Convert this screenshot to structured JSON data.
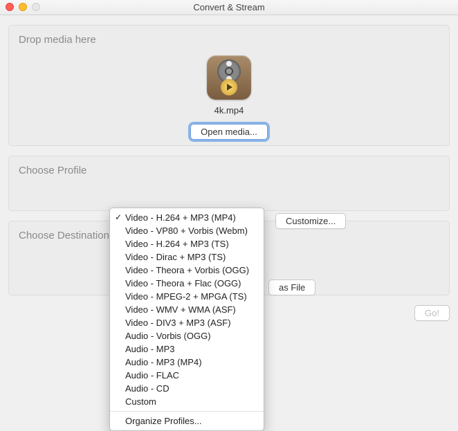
{
  "window": {
    "title": "Convert & Stream"
  },
  "drop": {
    "heading": "Drop media here",
    "filename": "4k.mp4",
    "open_label": "Open media..."
  },
  "profile": {
    "heading": "Choose Profile",
    "customize_label": "Customize...",
    "selected": "Video - H.264 + MP3 (MP4)",
    "options": [
      "Video - H.264 + MP3 (MP4)",
      "Video - VP80 + Vorbis (Webm)",
      "Video - H.264 + MP3 (TS)",
      "Video - Dirac + MP3 (TS)",
      "Video - Theora + Vorbis (OGG)",
      "Video - Theora + Flac (OGG)",
      "Video - MPEG-2 + MPGA (TS)",
      "Video - WMV + WMA (ASF)",
      "Video - DIV3 + MP3 (ASF)",
      "Audio - Vorbis (OGG)",
      "Audio - MP3",
      "Audio - MP3 (MP4)",
      "Audio - FLAC",
      "Audio - CD",
      "Custom"
    ],
    "organize_label": "Organize Profiles..."
  },
  "destination": {
    "heading": "Choose Destination",
    "as_file_label": "as File"
  },
  "go_label": "Go!"
}
